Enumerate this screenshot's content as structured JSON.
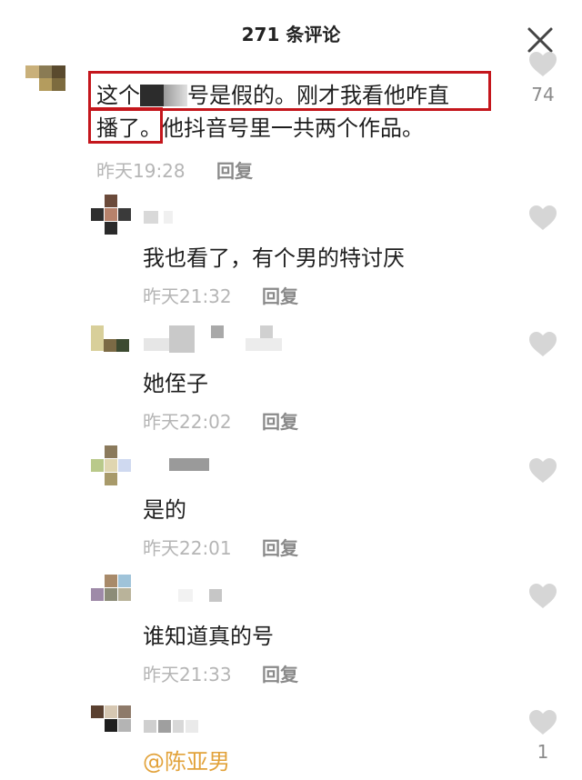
{
  "header": {
    "title": "271 条评论"
  },
  "comments": [
    {
      "text_line1_a": "这个",
      "text_line1_b": "号是假的。刚才我看他咋直",
      "text_line2_a": "播了。",
      "text_line2_b": "他抖音号里一共两个作品。",
      "time": "昨天19:28",
      "reply": "回复",
      "likes": "74"
    },
    {
      "text": "我也看了，有个男的特讨厌",
      "time": "昨天21:32",
      "reply": "回复"
    },
    {
      "text": "她侄子",
      "time": "昨天22:02",
      "reply": "回复"
    },
    {
      "text": "是的",
      "time": "昨天22:01",
      "reply": "回复"
    },
    {
      "text": "谁知道真的号",
      "time": "昨天21:33",
      "reply": "回复"
    },
    {
      "text": "@陈亚男",
      "likes": "1"
    }
  ],
  "icons": {
    "close": "close-icon",
    "like": "heart-icon"
  },
  "colors": {
    "highlight": "#c4161c",
    "mention": "#e2a23a",
    "heart": "#d6d6d6"
  }
}
